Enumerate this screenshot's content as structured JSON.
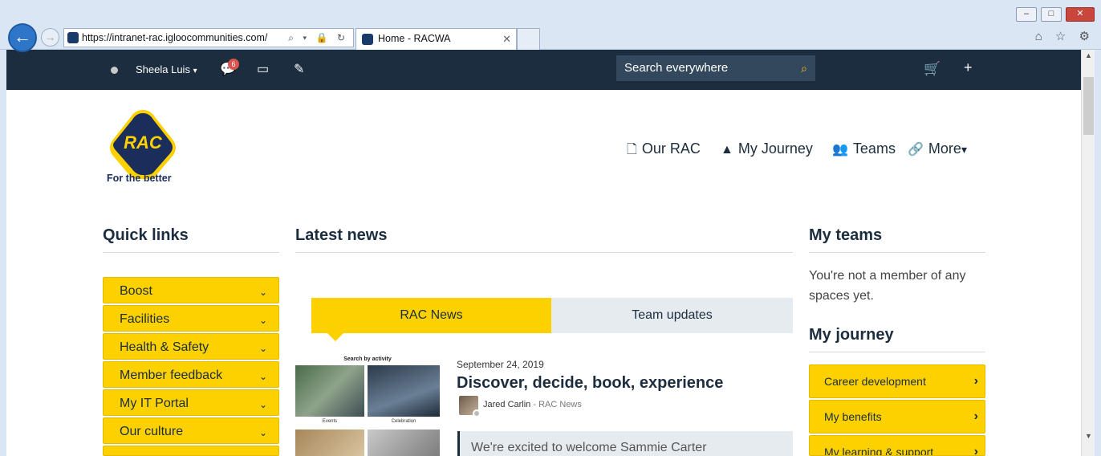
{
  "browser": {
    "url": "https://intranet-rac.igloocommunities.com/",
    "tab_title": "Home - RACWA",
    "tab_close": "✕",
    "win_min": "–",
    "win_max": "□",
    "win_close": "✕",
    "back_glyph": "←",
    "forward_glyph": "→",
    "address_tools": "⌕ ▾ 🔒 ↻",
    "right_icons": "⌂ ☆ ⚙"
  },
  "topbar": {
    "user_name": "Sheela Luis",
    "user_caret": "▾",
    "notifications_count": "6",
    "notifications_glyph": "💬",
    "bookmark_glyph": "▭",
    "compose_glyph": "✎",
    "search_placeholder": "Search everywhere",
    "search_glyph": "⌕",
    "cart_glyph": "🛒",
    "add_glyph": "+"
  },
  "logo": {
    "text": "RAC",
    "tagline": "For the better",
    "colors": {
      "navy": "#1b2d5a",
      "yellow": "#fdd100"
    }
  },
  "main_nav": [
    {
      "label": "Our RAC",
      "icon": "document-icon",
      "glyph": "🗋"
    },
    {
      "label": "My Journey",
      "icon": "road-icon",
      "glyph": "▲"
    },
    {
      "label": "Teams",
      "icon": "users-icon",
      "glyph": "👥"
    },
    {
      "label": "More",
      "icon": "link-icon",
      "glyph": "🔗",
      "caret": "▾"
    }
  ],
  "quick_links": {
    "title": "Quick links",
    "items": [
      "Boost",
      "Facilities",
      "Health & Safety",
      "Member feedback",
      "My IT Portal",
      "Our culture"
    ],
    "chevron": "⌄"
  },
  "latest_news": {
    "title": "Latest news",
    "tabs": [
      "RAC News",
      "Team updates"
    ],
    "article": {
      "image_header": "Search by activity",
      "image_caption_1": "Events",
      "image_caption_2": "Celebration",
      "date": "September 24, 2019",
      "title": "Discover, decide, book, experience",
      "author": "Jared Carlin",
      "separator": " - ",
      "source": "RAC News",
      "excerpt": "We're excited to welcome Sammie Carter"
    }
  },
  "my_teams": {
    "title": "My teams",
    "empty_text": "You're not a member of any spaces yet."
  },
  "my_journey": {
    "title": "My journey",
    "items": [
      "Career development",
      "My benefits",
      "My learning & support"
    ],
    "chevron": "›"
  },
  "colors": {
    "topbar_bg": "#1b2d3e",
    "accent_yellow": "#fdd100",
    "search_bg": "#33485d",
    "badge_red": "#d9534f"
  }
}
